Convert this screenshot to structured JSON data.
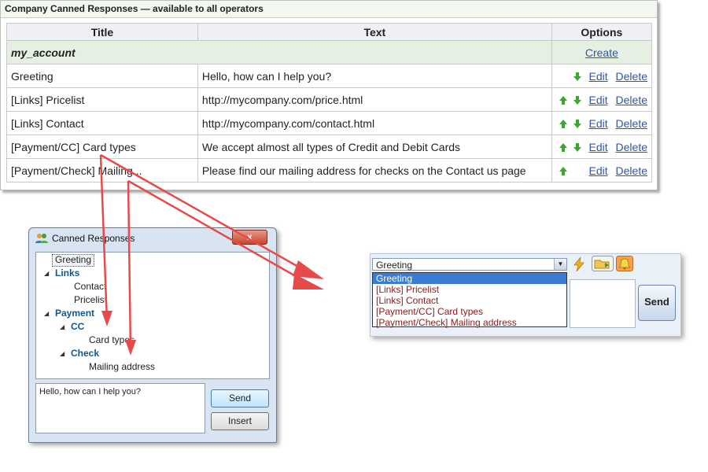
{
  "panel": {
    "title": "Company Canned Responses — available to all operators",
    "headers": [
      "Title",
      "Text",
      "Options"
    ],
    "group": {
      "name": "my_account",
      "action": "Create"
    },
    "rows": [
      {
        "title": "Greeting",
        "text": "Hello, how can I help you?",
        "up": false,
        "down": true
      },
      {
        "title": "[Links] Pricelist",
        "text": "http://mycompany.com/price.html",
        "up": true,
        "down": true
      },
      {
        "title": "[Links] Contact",
        "text": "http://mycompany.com/contact.html",
        "up": true,
        "down": true
      },
      {
        "title": "[Payment/CC] Card types",
        "text": "We accept almost all types of Credit and Debit Cards",
        "up": true,
        "down": true
      },
      {
        "title": "[Payment/Check] Mailing...",
        "text": "Please find our mailing address for checks on the Contact us page",
        "up": true,
        "down": false
      }
    ],
    "edit_label": "Edit",
    "delete_label": "Delete"
  },
  "dialog": {
    "title": "Canned Responses",
    "close": "x",
    "tree": {
      "greeting": "Greeting",
      "links": "Links",
      "contact": "Contact",
      "pricelist": "Pricelist",
      "payment": "Payment",
      "cc": "CC",
      "card_types": "Card types",
      "check": "Check",
      "mailing": "Mailing address"
    },
    "message": "Hello, how can I help you?",
    "send": "Send",
    "insert": "Insert"
  },
  "chat": {
    "selected": "Greeting",
    "options": [
      "Greeting",
      "[Links] Pricelist",
      "[Links] Contact",
      "[Payment/CC] Card types",
      "[Payment/Check] Mailing address"
    ],
    "send": "Send"
  },
  "colors": {
    "arrow": "#e84a4a",
    "group_bg": "#e6f0e2",
    "link": "#2d56a8",
    "arrow_icon": "#3aa82e"
  }
}
